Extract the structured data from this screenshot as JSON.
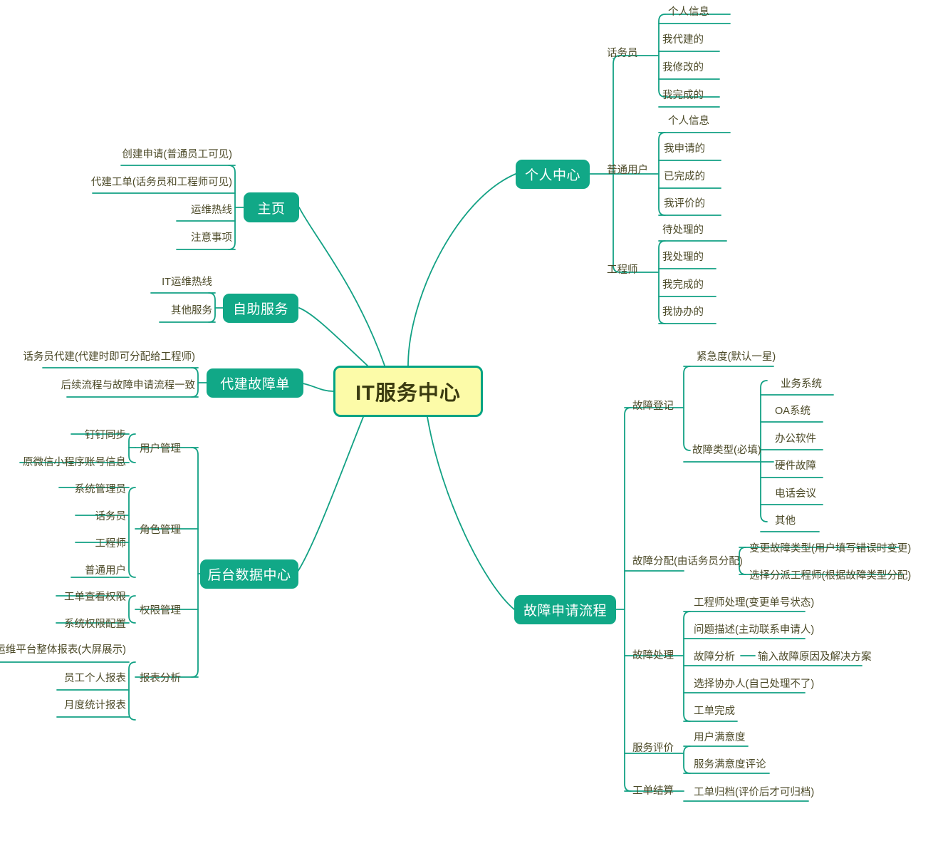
{
  "title": "IT服务中心",
  "colors": {
    "root_fill": "#FCFBA8",
    "root_border": "#00A383",
    "branch_fill": "#11A887",
    "branch_text": "#FFFFFF",
    "leaf_text": "#4C4A28",
    "edge": "#12A184",
    "edge_light": "#5BC4AD",
    "background": "#FFFFFF"
  },
  "root": {
    "label": "IT服务中心"
  },
  "branches": [
    {
      "id": "personal-center",
      "label": "个人中心",
      "children": [
        {
          "label": "话务员",
          "children": [
            {
              "label": "个人信息"
            },
            {
              "label": "我代建的"
            },
            {
              "label": "我修改的"
            },
            {
              "label": "我完成的"
            }
          ]
        },
        {
          "label": "普通用户",
          "children": [
            {
              "label": "个人信息"
            },
            {
              "label": "我申请的"
            },
            {
              "label": "已完成的"
            },
            {
              "label": "我评价的"
            }
          ]
        },
        {
          "label": "工程师",
          "children": [
            {
              "label": "待处理的"
            },
            {
              "label": "我处理的"
            },
            {
              "label": "我完成的"
            },
            {
              "label": "我协办的"
            }
          ]
        }
      ]
    },
    {
      "id": "home",
      "label": "主页",
      "children": [
        {
          "label": "创建申请(普通员工可见)"
        },
        {
          "label": "代建工单(话务员和工程师可见)"
        },
        {
          "label": "运维热线"
        },
        {
          "label": "注意事项"
        }
      ]
    },
    {
      "id": "self-service",
      "label": "自助服务",
      "children": [
        {
          "label": "IT运维热线"
        },
        {
          "label": "其他服务"
        }
      ]
    },
    {
      "id": "proxy-ticket",
      "label": "代建故障单",
      "children": [
        {
          "label": "话务员代建(代建时即可分配给工程师)"
        },
        {
          "label": "后续流程与故障申请流程一致"
        }
      ]
    },
    {
      "id": "backend-data-center",
      "label": "后台数据中心",
      "children": [
        {
          "label": "用户管理",
          "children": [
            {
              "label": "钉钉同步"
            },
            {
              "label": "原微信小程序账号信息"
            }
          ]
        },
        {
          "label": "角色管理",
          "children": [
            {
              "label": "系统管理员"
            },
            {
              "label": "话务员"
            },
            {
              "label": "工程师"
            },
            {
              "label": "普通用户"
            }
          ]
        },
        {
          "label": "权限管理",
          "children": [
            {
              "label": "工单查看权限"
            },
            {
              "label": "系统权限配置"
            }
          ]
        },
        {
          "label": "报表分析",
          "children": [
            {
              "label": "运维平台整体报表(大屏展示)"
            },
            {
              "label": "员工个人报表"
            },
            {
              "label": "月度统计报表"
            }
          ]
        }
      ]
    },
    {
      "id": "fault-request-flow",
      "label": "故障申请流程",
      "children": [
        {
          "label": "故障登记",
          "children": [
            {
              "label": "紧急度(默认一星)"
            },
            {
              "label": "故障类型(必填)",
              "children": [
                {
                  "label": "业务系统"
                },
                {
                  "label": "OA系统"
                },
                {
                  "label": "办公软件"
                },
                {
                  "label": "硬件故障"
                },
                {
                  "label": "电话会议"
                },
                {
                  "label": "其他"
                }
              ]
            }
          ]
        },
        {
          "label": "故障分配(由话务员分配)",
          "children": [
            {
              "label": "变更故障类型(用户填写错误时变更)"
            },
            {
              "label": "选择分派工程师(根据故障类型分配)"
            }
          ]
        },
        {
          "label": "故障处理",
          "children": [
            {
              "label": "工程师处理(变更单号状态)"
            },
            {
              "label": "问题描述(主动联系申请人)"
            },
            {
              "label": "故障分析",
              "children": [
                {
                  "label": "输入故障原因及解决方案"
                }
              ]
            },
            {
              "label": "选择协办人(自己处理不了)"
            },
            {
              "label": "工单完成"
            }
          ]
        },
        {
          "label": "服务评价",
          "children": [
            {
              "label": "用户满意度"
            },
            {
              "label": "服务满意度评论"
            }
          ]
        },
        {
          "label": "工单结算",
          "children": [
            {
              "label": "工单归档(评价后才可归档)"
            }
          ]
        }
      ]
    }
  ]
}
